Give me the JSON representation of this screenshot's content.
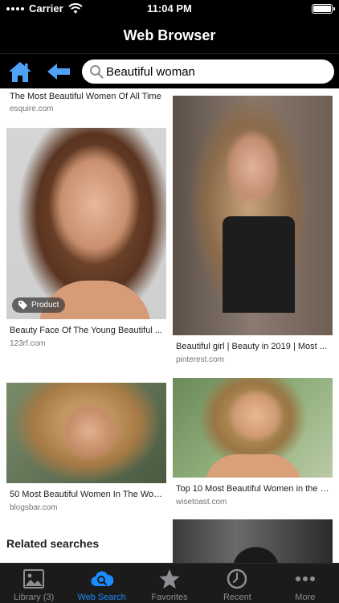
{
  "status": {
    "carrier": "Carrier",
    "time": "11:04 PM"
  },
  "app": {
    "title": "Web Browser"
  },
  "search": {
    "query": "Beautiful woman"
  },
  "results": {
    "top_left": {
      "title": "The Most Beautiful Women Of All Time",
      "source": "esquire.com"
    },
    "card1": {
      "title": "Beauty Face Of The Young Beautiful ...",
      "source": "123rf.com",
      "badge": "Product"
    },
    "card2": {
      "title": "Beautiful girl | Beauty in 2019 | Most ...",
      "source": "pinterest.com"
    },
    "card3": {
      "title": "50 Most Beautiful Women In The Worl...",
      "source": "blogsbar.com"
    },
    "card4": {
      "title": "Top 10 Most Beautiful Women in the W...",
      "source": "wisetoast.com"
    }
  },
  "related": {
    "heading": "Related searches"
  },
  "tabs": [
    {
      "label": "Library (3)",
      "icon": "photo-library-icon"
    },
    {
      "label": "Web Search",
      "icon": "cloud-search-icon"
    },
    {
      "label": "Favorites",
      "icon": "star-icon"
    },
    {
      "label": "Recent",
      "icon": "clock-icon"
    },
    {
      "label": "More",
      "icon": "more-dots-icon"
    }
  ],
  "colors": {
    "accent": "#1a8cff",
    "toolbar_icon": "#4fa3f7"
  }
}
